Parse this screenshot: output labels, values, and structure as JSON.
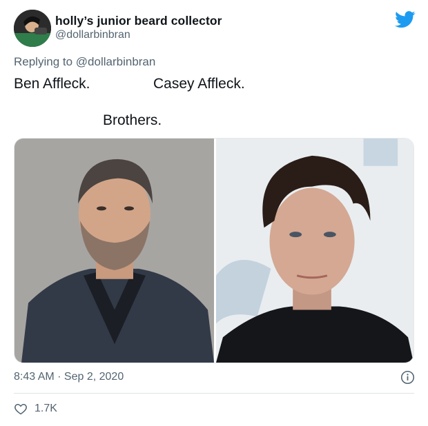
{
  "author": {
    "display_name": "holly’s junior beard collector",
    "handle": "@dollarbinbran",
    "avatar_icon": "profile-photo"
  },
  "reply": {
    "prefix": "Replying to",
    "mention": "@dollarbinbran"
  },
  "tweet": {
    "line1_left": "Ben Affleck.",
    "line1_right": "Casey Affleck.",
    "line2": "Brothers."
  },
  "media": {
    "left_photo_icon": "photo-ben-affleck",
    "right_photo_icon": "photo-casey-affleck"
  },
  "meta": {
    "timestamp": "8:43 AM · Sep 2, 2020"
  },
  "actions": {
    "like_count": "1.7K",
    "like_icon": "heart-icon",
    "info_icon": "info-icon",
    "brand_icon": "twitter-bird-icon"
  },
  "colors": {
    "brand": "#1d9bf0",
    "secondary_text": "#536471",
    "primary_text": "#0f1419",
    "divider": "#dde3e7"
  }
}
